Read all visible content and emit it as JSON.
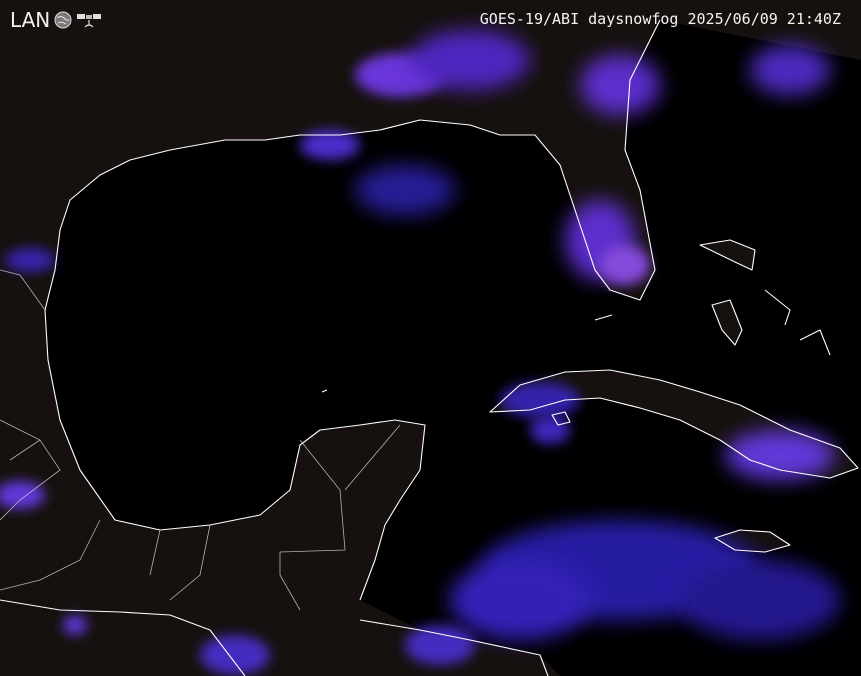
{
  "header": {
    "logo_text": "LAN",
    "title": "GOES-19/ABI daysnowfog 2025/06/09 21:40Z"
  },
  "icons": {
    "logo_globe": "globe-icon",
    "logo_satellite": "satellite-icon"
  },
  "colors": {
    "background": "#000000",
    "land": "#1a1410",
    "coastline": "#ffffff",
    "cloud": "#5b2cf0",
    "cloud_bright": "#8f4cff"
  }
}
